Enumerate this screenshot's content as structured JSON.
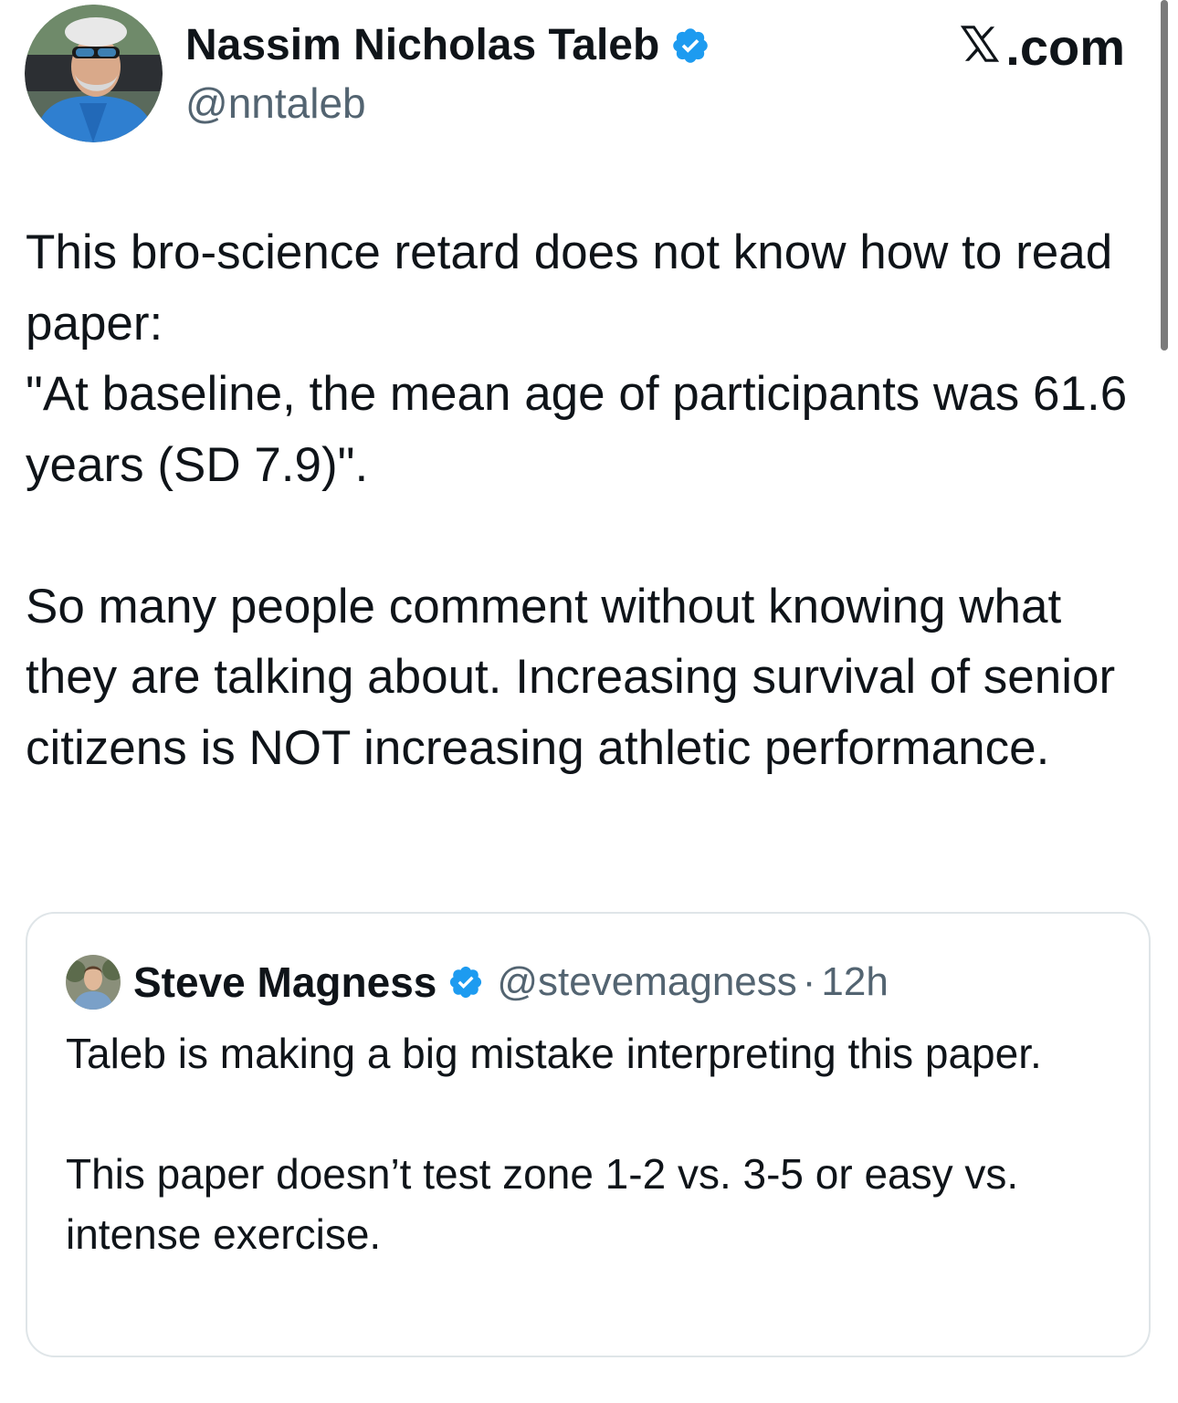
{
  "author": {
    "name": "Nassim Nicholas Taleb",
    "handle": "@nntaleb",
    "verified": true
  },
  "site": {
    "label": ".com",
    "icon": "x-logo-icon"
  },
  "tweet": {
    "paragraph1_line1": "This bro-science retard does not know how to read paper:",
    "paragraph1_line2": "\"At baseline, the mean age of participants was 61.6 years (SD 7.9)\".",
    "paragraph2": "So many people comment without knowing what they are talking about. Increasing survival of senior citizens is NOT increasing athletic performance."
  },
  "quoted_tweet": {
    "name": "Steve Magness",
    "handle": "@stevemagness",
    "separator": "·",
    "time": "12h",
    "verified": true,
    "paragraph1": "Taleb is making a big mistake interpreting this paper.",
    "paragraph2": "This paper doesn’t test zone 1-2 vs. 3-5 or easy vs. intense exercise."
  },
  "colors": {
    "text": "#0f1419",
    "secondary_text": "#536471",
    "verified_badge": "#1d9bf0",
    "card_border": "#dfe5e8"
  }
}
